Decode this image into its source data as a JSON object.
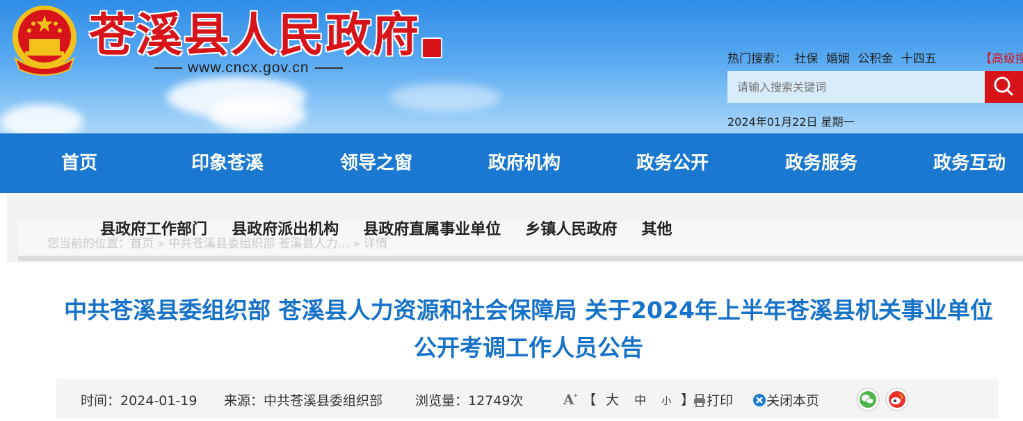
{
  "header": {
    "site_title": "苍溪县人民政府",
    "site_url": "www.cncx.gov.cn",
    "hot_search_label": "热门搜索：",
    "hot_search_terms": [
      "社保",
      "婚姻",
      "公积金",
      "十四五"
    ],
    "advanced_search": "【高级搜",
    "search_placeholder": "请输入搜索关键词",
    "date": "2024年01月22日 星期一"
  },
  "nav": {
    "items": [
      "首页",
      "印象苍溪",
      "领导之窗",
      "政府机构",
      "政务公开",
      "政务服务",
      "政务互动"
    ]
  },
  "sub_nav": {
    "items": [
      "县政府工作部门",
      "县政府派出机构",
      "县政府直属事业单位",
      "乡镇人民政府",
      "其他"
    ]
  },
  "breadcrumb": "您当前的位置：首页 » 中共苍溪县委组织部 苍溪县人力... » 详情",
  "article": {
    "title_line1": "中共苍溪县委组织部 苍溪县人力资源和社会保障局 关于2024年上半年苍溪县机关事业单位",
    "title_line2": "公开考调工作人员公告",
    "time": "时间：2024-01-19",
    "source": "来源：中共苍溪县委组织部",
    "views": "浏览量：12749次",
    "font_bracket_open": "【",
    "font_large": "大",
    "font_medium": "中",
    "font_small": "小",
    "font_bracket_close": "】",
    "print": "打印",
    "close": "关闭本页"
  },
  "colors": {
    "nav_blue": "#1a78d0",
    "title_red": "#d8141b",
    "article_title_blue": "#1671c8"
  }
}
